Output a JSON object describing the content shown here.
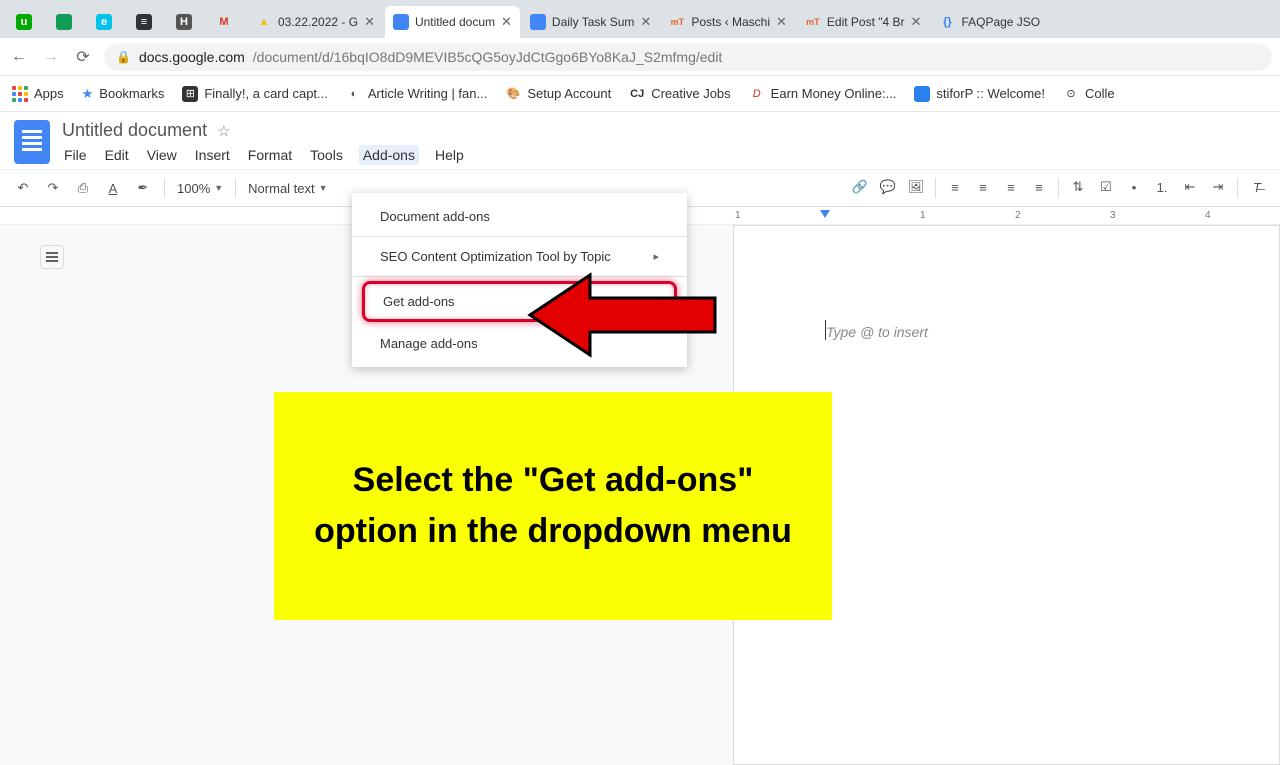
{
  "tabs": [
    {
      "favicon_bg": "#01a801",
      "favicon_text": "u",
      "title": ""
    },
    {
      "favicon_bg": "#0f9d58",
      "favicon_text": "",
      "title": ""
    },
    {
      "favicon_bg": "#03c4e8",
      "favicon_text": "e",
      "title": ""
    },
    {
      "favicon_bg": "#333",
      "favicon_text": "≡",
      "title": ""
    },
    {
      "favicon_bg": "#555",
      "favicon_text": "H",
      "title": ""
    },
    {
      "favicon_bg": "#fff",
      "favicon_text": "M",
      "title": ""
    },
    {
      "favicon_bg": "#fbbc04",
      "favicon_text": "▲",
      "title": "03.22.2022 - G"
    },
    {
      "favicon_bg": "#4285f4",
      "favicon_text": "",
      "title": "Untitled docum",
      "active": true
    },
    {
      "favicon_bg": "#4285f4",
      "favicon_text": "",
      "title": "Daily Task Sum"
    },
    {
      "favicon_bg": "#fff",
      "favicon_text": "mT",
      "title": "Posts ‹ Maschi"
    },
    {
      "favicon_bg": "#fff",
      "favicon_text": "mT",
      "title": "Edit Post \"4 Br"
    },
    {
      "favicon_bg": "#2980ef",
      "favicon_text": "{}",
      "title": "FAQPage JSO"
    }
  ],
  "url": {
    "host": "docs.google.com",
    "path": "/document/d/16bqIO8dD9MEVIB5cQG5oyJdCtGgo6BYo8KaJ_S2mfmg/edit"
  },
  "bookmarks": [
    {
      "label": "Apps"
    },
    {
      "label": "Bookmarks"
    },
    {
      "label": "Finally!, a card capt..."
    },
    {
      "label": "Article Writing | fan..."
    },
    {
      "label": "Setup Account"
    },
    {
      "label": "Creative Jobs"
    },
    {
      "label": "Earn Money Online:..."
    },
    {
      "label": "stiforP :: Welcome!"
    },
    {
      "label": "Colle"
    }
  ],
  "doc": {
    "title": "Untitled document"
  },
  "menus": {
    "file": "File",
    "edit": "Edit",
    "view": "View",
    "insert": "Insert",
    "format": "Format",
    "tools": "Tools",
    "addons": "Add-ons",
    "help": "Help"
  },
  "toolbar": {
    "zoom": "100%",
    "style": "Normal text"
  },
  "dropdown": {
    "doc_addons": "Document add-ons",
    "seo_tool": "SEO Content Optimization Tool by Topic",
    "get_addons": "Get add-ons",
    "manage_addons": "Manage add-ons"
  },
  "ruler": {
    "n1": "1",
    "n2": "2",
    "n3": "3",
    "n4": "4"
  },
  "placeholder": "Type @ to insert",
  "callout": "Select the \"Get add-ons\" option in the dropdown menu"
}
